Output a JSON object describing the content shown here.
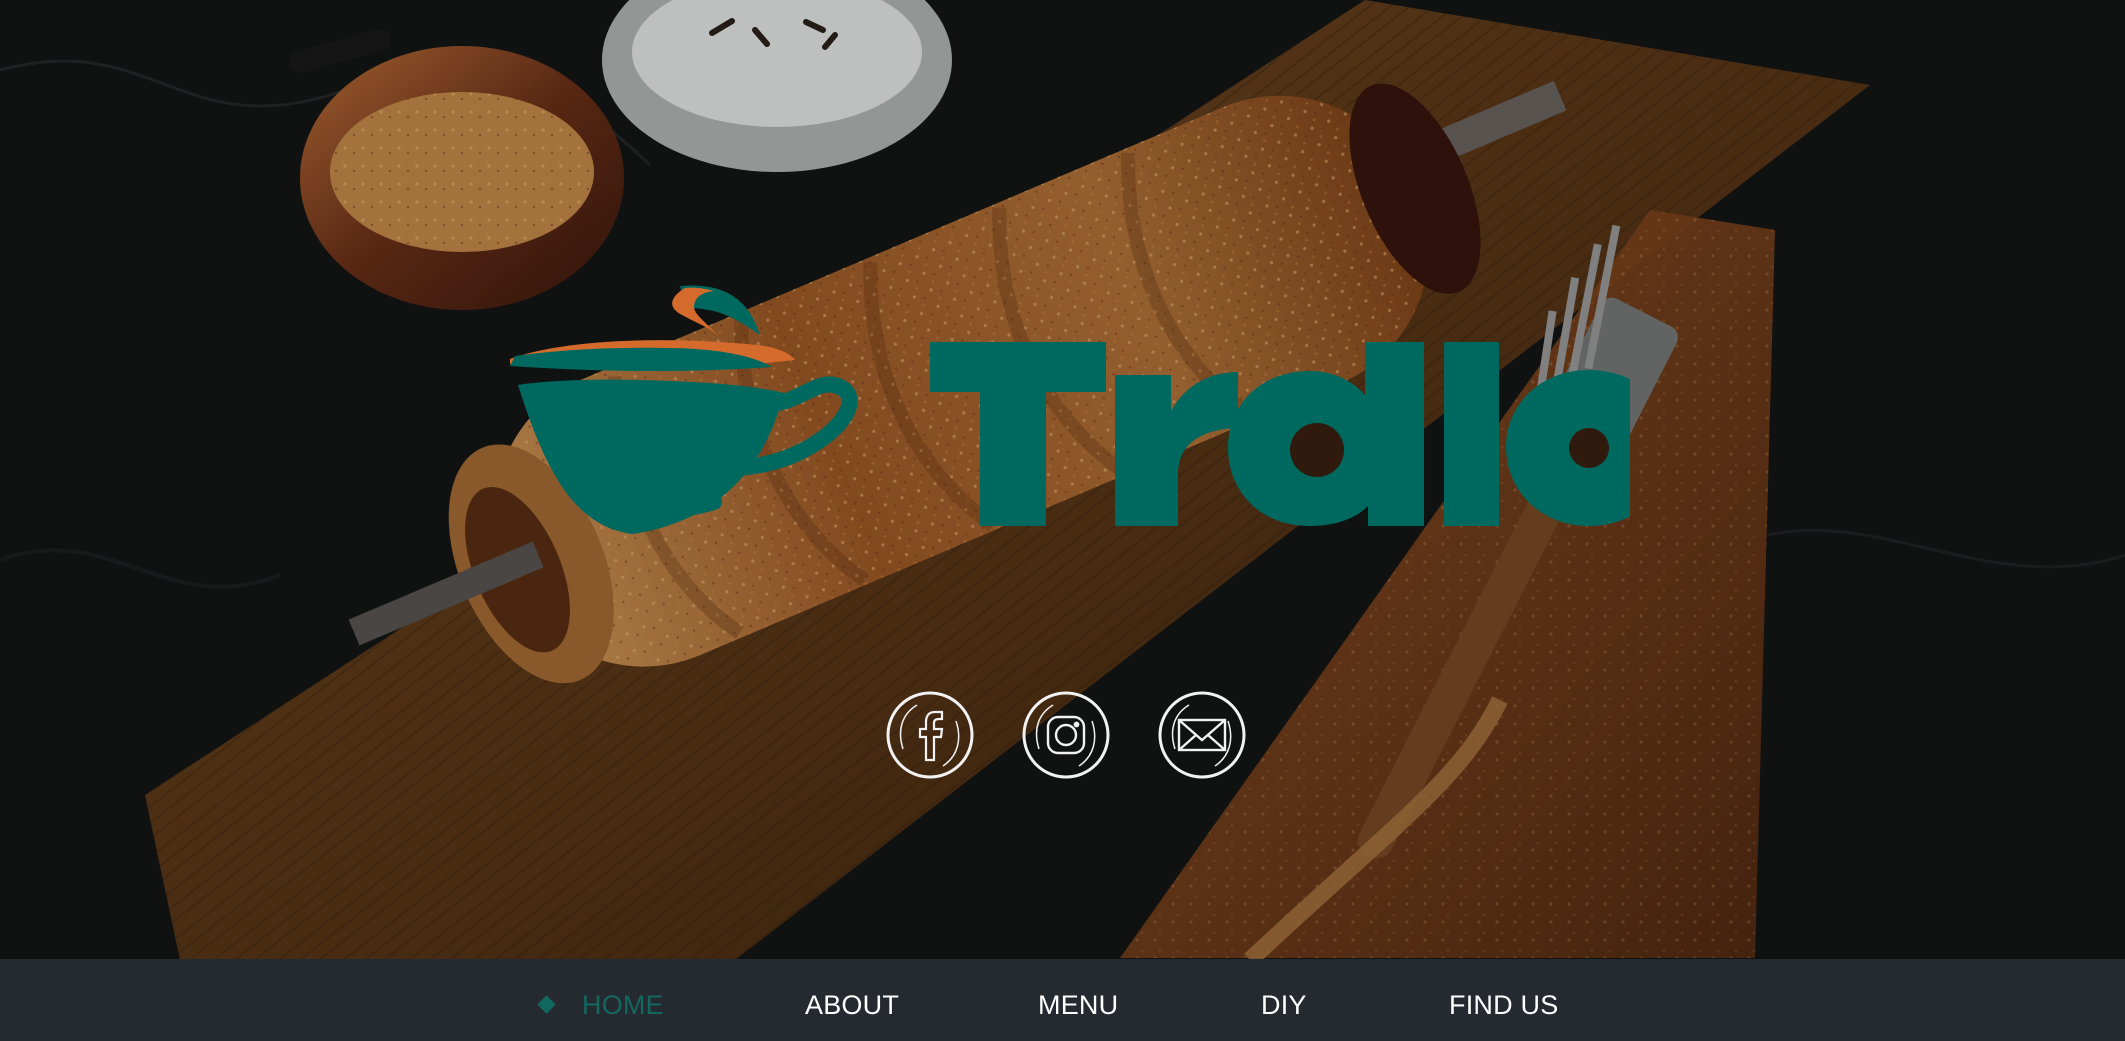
{
  "brand": {
    "logo_name": "Trdlo",
    "logo_icon": "coffee-cup-icon",
    "primary_color": "#00695f",
    "accent_color": "#d46b2c"
  },
  "social": [
    {
      "name": "facebook-icon",
      "glyph": "f"
    },
    {
      "name": "instagram-icon",
      "glyph": "◎"
    },
    {
      "name": "email-icon",
      "glyph": "✉"
    }
  ],
  "nav": {
    "items": [
      {
        "label": "HOME"
      },
      {
        "label": "ABOUT"
      },
      {
        "label": "MENU"
      },
      {
        "label": "DIY"
      },
      {
        "label": "FIND US"
      }
    ]
  },
  "colors": {
    "nav_background": "#252a31",
    "nav_text": "#ffffff",
    "active_nav": "#12675e",
    "social_outline": "#f2f2f2"
  }
}
